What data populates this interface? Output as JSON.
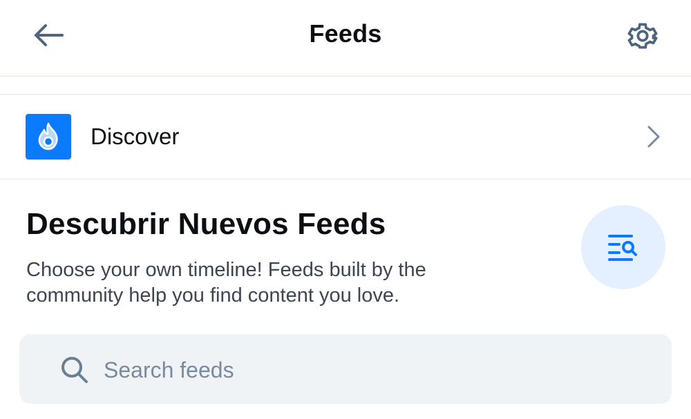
{
  "header": {
    "title": "Feeds",
    "back_icon": "arrow-left-icon",
    "settings_icon": "gear-icon"
  },
  "saved_feeds": [
    {
      "name": "Discover",
      "icon": "flame-icon",
      "icon_bg": "#0a7aff"
    }
  ],
  "discover_section": {
    "title": "Descubrir Nuevos Feeds",
    "description": "Choose your own timeline! Feeds built by the community help you find content you love.",
    "icon": "list-search-icon"
  },
  "search": {
    "placeholder": "Search feeds",
    "value": ""
  },
  "colors": {
    "accent": "#0a7aff",
    "icon_gray": "#4d6580",
    "border": "#e4e8ec",
    "search_bg": "#f0f3f5",
    "discover_circle_bg": "#e4f0ff"
  }
}
